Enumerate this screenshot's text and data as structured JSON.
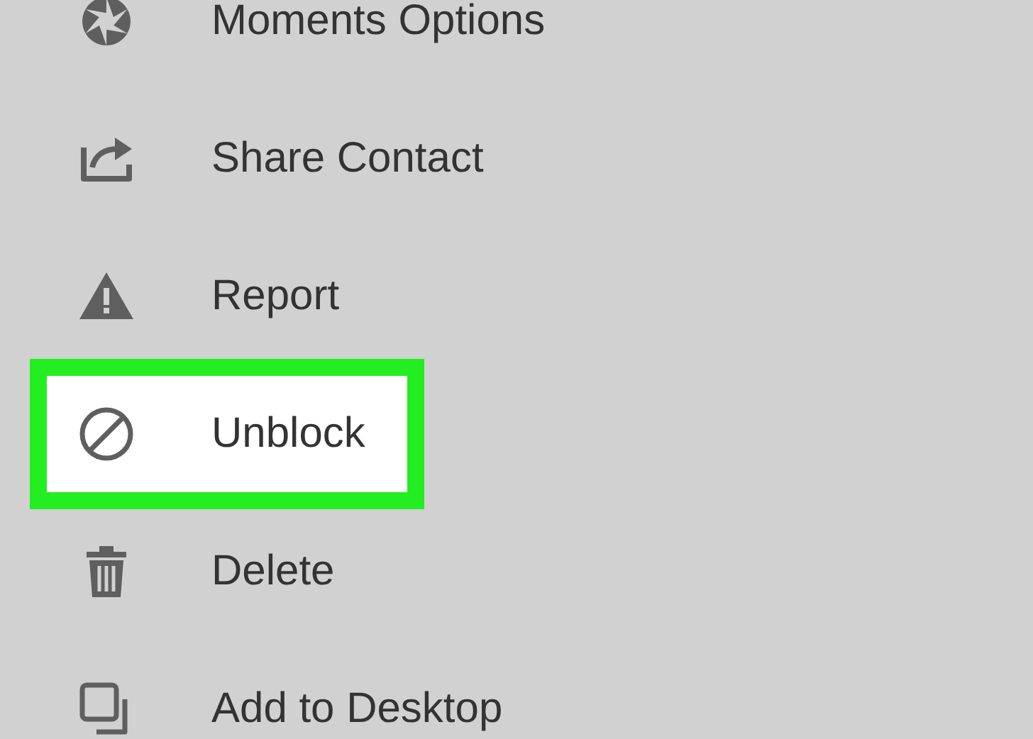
{
  "menu": {
    "items": [
      {
        "kind": "moments",
        "label": "Moments Options",
        "highlighted": false
      },
      {
        "kind": "share",
        "label": "Share Contact",
        "highlighted": false
      },
      {
        "kind": "report",
        "label": "Report",
        "highlighted": false
      },
      {
        "kind": "block",
        "label": "Unblock",
        "highlighted": true
      },
      {
        "kind": "delete",
        "label": "Delete",
        "highlighted": false
      },
      {
        "kind": "desktop",
        "label": "Add to Desktop",
        "highlighted": false
      }
    ]
  }
}
